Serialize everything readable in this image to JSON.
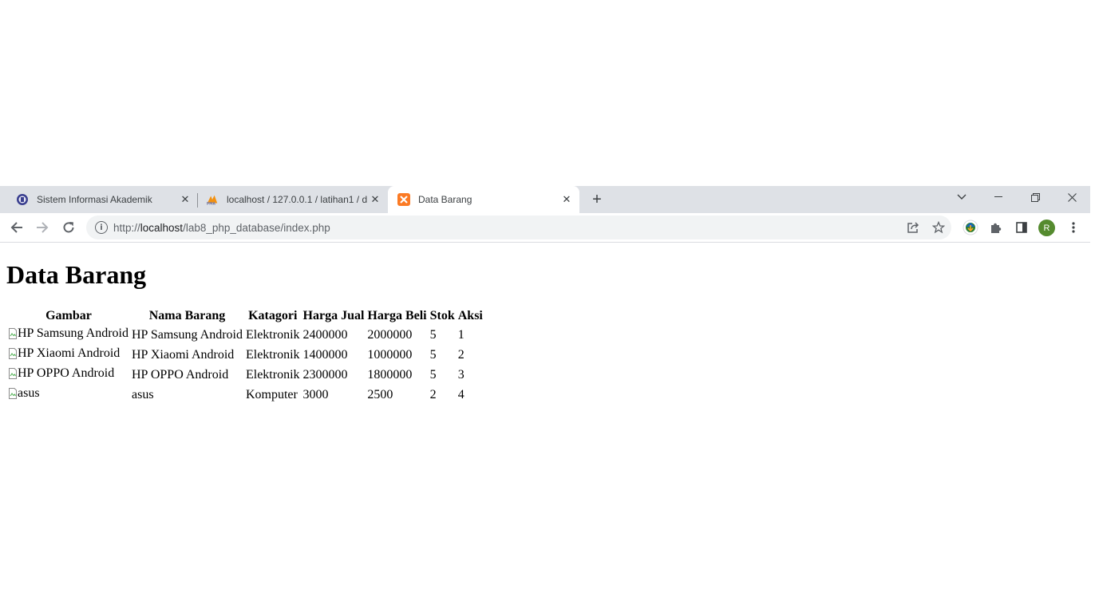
{
  "browser": {
    "tabs": [
      {
        "title": "Sistem Informasi Akademik",
        "active": false
      },
      {
        "title": "localhost / 127.0.0.1 / latihan1 / d",
        "active": false
      },
      {
        "title": "Data Barang",
        "active": true
      }
    ],
    "address": {
      "scheme": "http://",
      "host": "localhost",
      "path": "/lab8_php_database/index.php"
    },
    "profile_initial": "R"
  },
  "page": {
    "heading": "Data Barang",
    "table": {
      "headers": [
        "Gambar",
        "Nama Barang",
        "Katagori",
        "Harga Jual",
        "Harga Beli",
        "Stok",
        "Aksi"
      ],
      "rows": [
        {
          "gambar_alt": "HP Samsung Android",
          "nama": "HP Samsung Android",
          "kategori": "Elektronik",
          "harga_jual": "2400000",
          "harga_beli": "2000000",
          "stok": "5",
          "aksi": "1"
        },
        {
          "gambar_alt": "HP Xiaomi Android",
          "nama": "HP Xiaomi Android",
          "kategori": "Elektronik",
          "harga_jual": "1400000",
          "harga_beli": "1000000",
          "stok": "5",
          "aksi": "2"
        },
        {
          "gambar_alt": "HP OPPO Android",
          "nama": "HP OPPO Android",
          "kategori": "Elektronik",
          "harga_jual": "2300000",
          "harga_beli": "1800000",
          "stok": "5",
          "aksi": "3"
        },
        {
          "gambar_alt": "asus",
          "nama": "asus",
          "kategori": "Komputer",
          "harga_jual": "3000",
          "harga_beli": "2500",
          "stok": "2",
          "aksi": "4"
        }
      ]
    }
  },
  "colors": {
    "tabstrip": "#dee1e6",
    "omnibox": "#f1f3f4",
    "avatar": "#558b2f"
  }
}
